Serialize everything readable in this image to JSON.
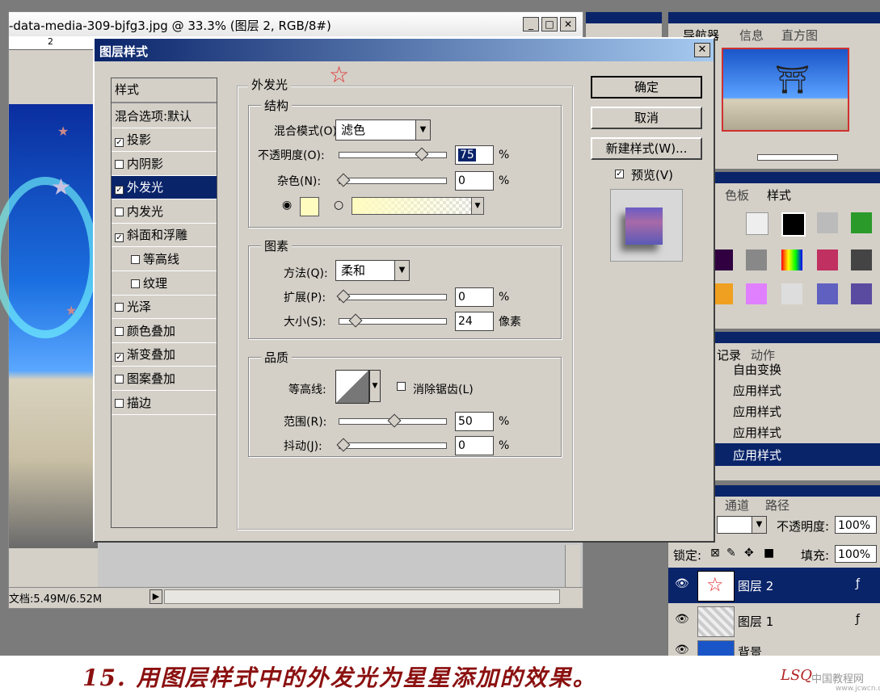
{
  "doc": {
    "title": "-data-media-309-bjfg3.jpg @ 33.3% (图层 2, RGB/8#)",
    "ruler_mark": "2",
    "status": "文档:5.49M/6.52M"
  },
  "right_panels": {
    "navigator_tabs": [
      "导航器",
      "信息",
      "直方图"
    ],
    "style_tabs": [
      "色板",
      "样式"
    ],
    "history_tabs": [
      "记录",
      "动作"
    ],
    "history_items": [
      "自由变换",
      "应用样式",
      "应用样式",
      "应用样式",
      "应用样式"
    ],
    "layers_tabs": [
      "通道",
      "路径"
    ],
    "opacity_label": "不透明度:",
    "opacity_value": "100%",
    "lock_label": "锁定:",
    "fill_label": "填充:",
    "fill_value": "100%",
    "layers": [
      "图层 2",
      "图层 1",
      "背景"
    ]
  },
  "dialog": {
    "title": "图层样式",
    "styles_header": "样式",
    "blend_default": "混合选项:默认",
    "style_items": [
      {
        "label": "投影",
        "checked": true
      },
      {
        "label": "内阴影",
        "checked": false
      },
      {
        "label": "外发光",
        "checked": true,
        "selected": true
      },
      {
        "label": "内发光",
        "checked": false
      },
      {
        "label": "斜面和浮雕",
        "checked": true
      },
      {
        "label": "等高线",
        "checked": false,
        "indent": true
      },
      {
        "label": "纹理",
        "checked": false,
        "indent": true
      },
      {
        "label": "光泽",
        "checked": false
      },
      {
        "label": "颜色叠加",
        "checked": false
      },
      {
        "label": "渐变叠加",
        "checked": true
      },
      {
        "label": "图案叠加",
        "checked": false
      },
      {
        "label": "描边",
        "checked": false
      }
    ],
    "section_title": "外发光",
    "structure": {
      "title": "结构",
      "blend_mode_label": "混合模式(O):",
      "blend_mode_value": "滤色",
      "opacity_label": "不透明度(O):",
      "opacity_value": "75",
      "noise_label": "杂色(N):",
      "noise_value": "0",
      "percent": "%",
      "glow_color": "#fffcc0"
    },
    "elements": {
      "title": "图素",
      "method_label": "方法(Q):",
      "method_value": "柔和",
      "spread_label": "扩展(P):",
      "spread_value": "0",
      "size_label": "大小(S):",
      "size_value": "24",
      "px_unit": "像素"
    },
    "quality": {
      "title": "品质",
      "contour_label": "等高线:",
      "antialias_label": "消除锯齿(L)",
      "range_label": "范围(R):",
      "range_value": "50",
      "jitter_label": "抖动(J):",
      "jitter_value": "0"
    },
    "buttons": {
      "ok": "确定",
      "cancel": "取消",
      "new_style": "新建样式(W)...",
      "preview": "预览(V)"
    }
  },
  "caption": "15. 用图层样式中的外发光为星星添加的效果。",
  "logo": {
    "mark": "LSQ",
    "site": "中国教程网",
    "url": "www.jcwcn.com"
  }
}
